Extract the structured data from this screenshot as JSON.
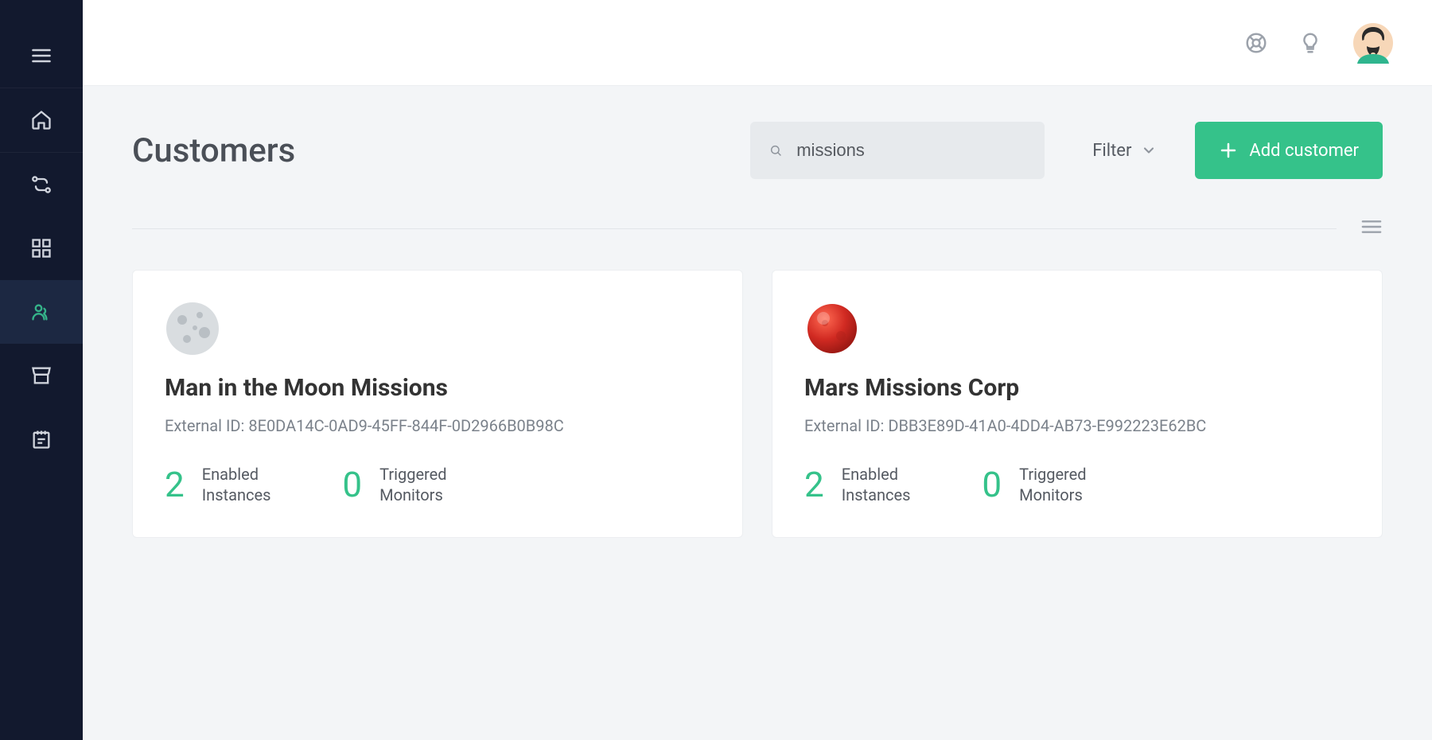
{
  "page": {
    "title": "Customers"
  },
  "search": {
    "value": "missions"
  },
  "filter": {
    "label": "Filter"
  },
  "addButton": {
    "label": "Add customer"
  },
  "statLabels": {
    "enabled_line1": "Enabled",
    "enabled_line2": "Instances",
    "triggered_line1": "Triggered",
    "triggered_line2": "Monitors"
  },
  "customers": [
    {
      "name": "Man in the Moon Missions",
      "external_id_label": "External ID: 8E0DA14C-0AD9-45FF-844F-0D2966B0B98C",
      "enabled_instances": "2",
      "triggered_monitors": "0",
      "icon": "moon"
    },
    {
      "name": "Mars Missions Corp",
      "external_id_label": "External ID: DBB3E89D-41A0-4DD4-AB73-E992223E62BC",
      "enabled_instances": "2",
      "triggered_monitors": "0",
      "icon": "mars"
    }
  ],
  "colors": {
    "accent": "#35c28a",
    "sidebar": "#12192e"
  }
}
